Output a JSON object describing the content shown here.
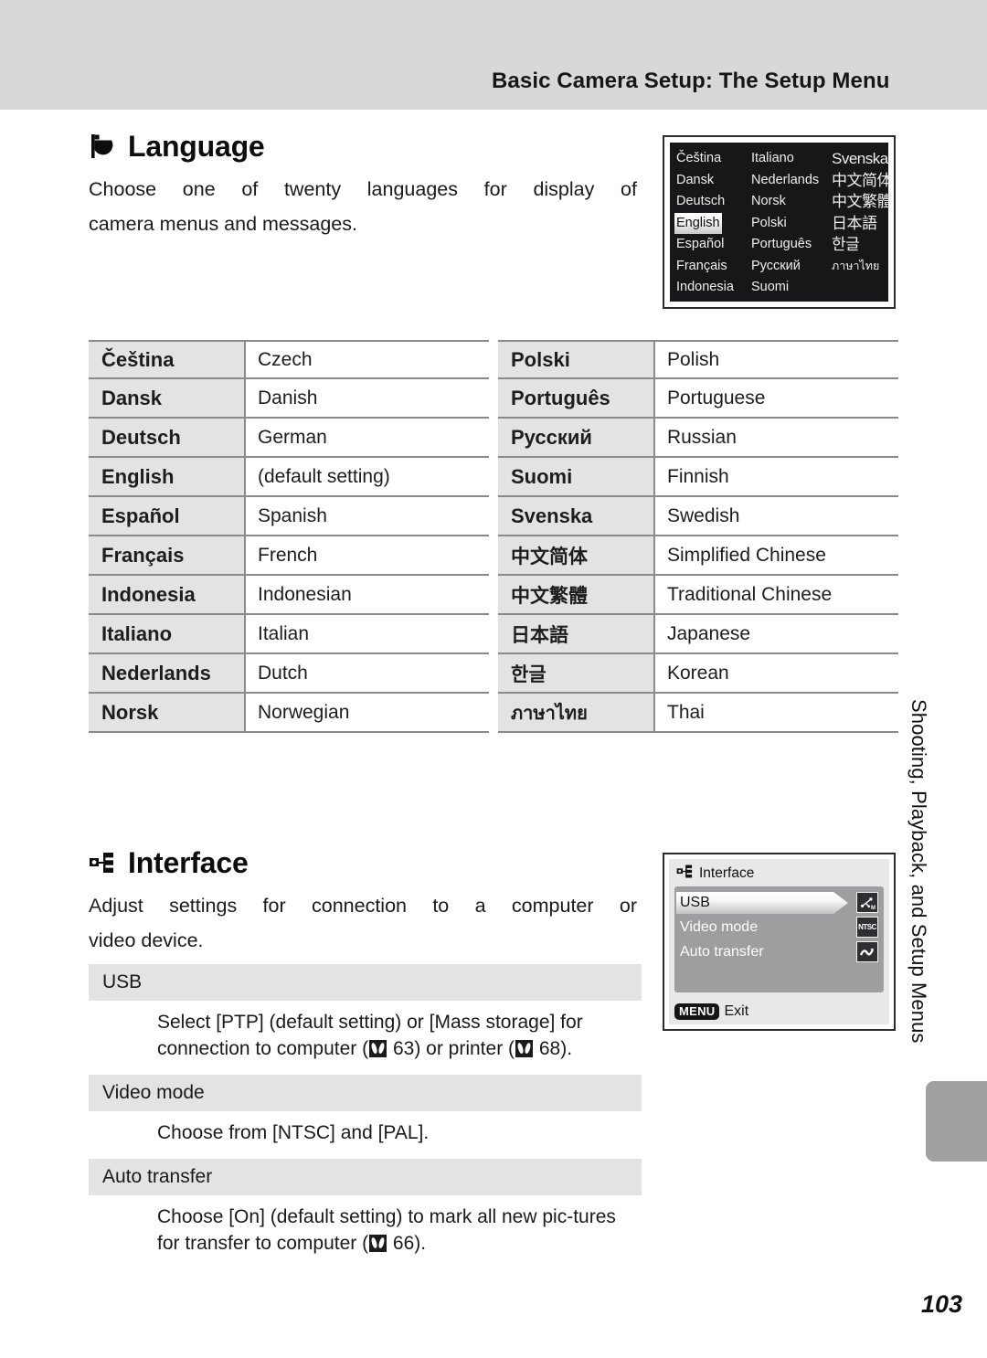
{
  "header": {
    "title": "Basic Camera Setup: The Setup Menu"
  },
  "language_section": {
    "icon": "flag-icon",
    "title": "Language",
    "body_line_1": "Choose one of twenty languages for display of",
    "body_line_2": "camera menus and messages.",
    "lcd": {
      "name": "language-selection-lcd",
      "selected": "English",
      "grid": [
        [
          "Čeština",
          "Italiano",
          "Svenska"
        ],
        [
          "Dansk",
          "Nederlands",
          "中文简体"
        ],
        [
          "Deutsch",
          "Norsk",
          "中文繁體"
        ],
        [
          "English",
          "Polski",
          "日本語"
        ],
        [
          "Español",
          "Português",
          "한글"
        ],
        [
          "Français",
          "Русский",
          "ภาษาไทย"
        ],
        [
          "Indonesia",
          "Suomi",
          ""
        ]
      ]
    },
    "table_left": [
      {
        "native": "Čeština",
        "english": "Czech"
      },
      {
        "native": "Dansk",
        "english": "Danish"
      },
      {
        "native": "Deutsch",
        "english": "German"
      },
      {
        "native": "English",
        "english": "(default setting)"
      },
      {
        "native": "Español",
        "english": "Spanish"
      },
      {
        "native": "Français",
        "english": "French"
      },
      {
        "native": "Indonesia",
        "english": "Indonesian"
      },
      {
        "native": "Italiano",
        "english": "Italian"
      },
      {
        "native": "Nederlands",
        "english": "Dutch"
      },
      {
        "native": "Norsk",
        "english": "Norwegian"
      }
    ],
    "table_right": [
      {
        "native": "Polski",
        "english": "Polish"
      },
      {
        "native": "Português",
        "english": "Portuguese"
      },
      {
        "native": "Русский",
        "english": "Russian"
      },
      {
        "native": "Suomi",
        "english": "Finnish"
      },
      {
        "native": "Svenska",
        "english": "Swedish"
      },
      {
        "native": "中文简体",
        "english": "Simplified Chinese"
      },
      {
        "native": "中文繁體",
        "english": "Traditional Chinese"
      },
      {
        "native": "日本語",
        "english": "Japanese"
      },
      {
        "native": "한글",
        "english": "Korean"
      },
      {
        "native": "ภาษาไทย",
        "english": "Thai"
      }
    ]
  },
  "interface_section": {
    "icon": "interface-network-icon",
    "title": "Interface",
    "body_line_1": "Adjust settings for connection to a computer or",
    "body_line_2": "video device.",
    "lcd": {
      "name": "interface-menu-lcd",
      "title": "Interface",
      "items": [
        {
          "label": "USB",
          "icon": "usb-icon",
          "icon_text": "⇢",
          "selected": true
        },
        {
          "label": "Video mode",
          "icon": "ntsc-icon",
          "icon_text": "NTSC",
          "selected": false
        },
        {
          "label": "Auto transfer",
          "icon": "auto-transfer-icon",
          "icon_text": "∿",
          "selected": false
        }
      ],
      "footer_badge": "MENU",
      "footer_label": "Exit"
    },
    "definitions": [
      {
        "term": "USB",
        "desc_pre": "Select [PTP] (default setting) or [Mass storage] for connection to computer (",
        "desc_ref1": "63",
        "desc_mid": ") or printer (",
        "desc_ref2": "68",
        "desc_post": ")."
      },
      {
        "term": "Video mode",
        "desc_plain": "Choose from [NTSC] and [PAL]."
      },
      {
        "term": "Auto transfer",
        "desc_pre": "Choose [On] (default setting) to mark all new pic-tures for transfer to computer (",
        "desc_ref1": "66",
        "desc_post": ")."
      }
    ]
  },
  "side_tab": {
    "label": "Shooting, Playback, and Setup Menus"
  },
  "page_number": "103",
  "colors": {
    "header_band": "#d8d8d8",
    "table_label_bg": "#e3e3e3",
    "table_border": "#8a8a8a",
    "lcd_language_bg": "#17171a",
    "lcd_interface_bg": "#e8e8e8",
    "lcd_panel_bg": "#9c9ea0",
    "side_tab_block": "#a0a0a0"
  }
}
